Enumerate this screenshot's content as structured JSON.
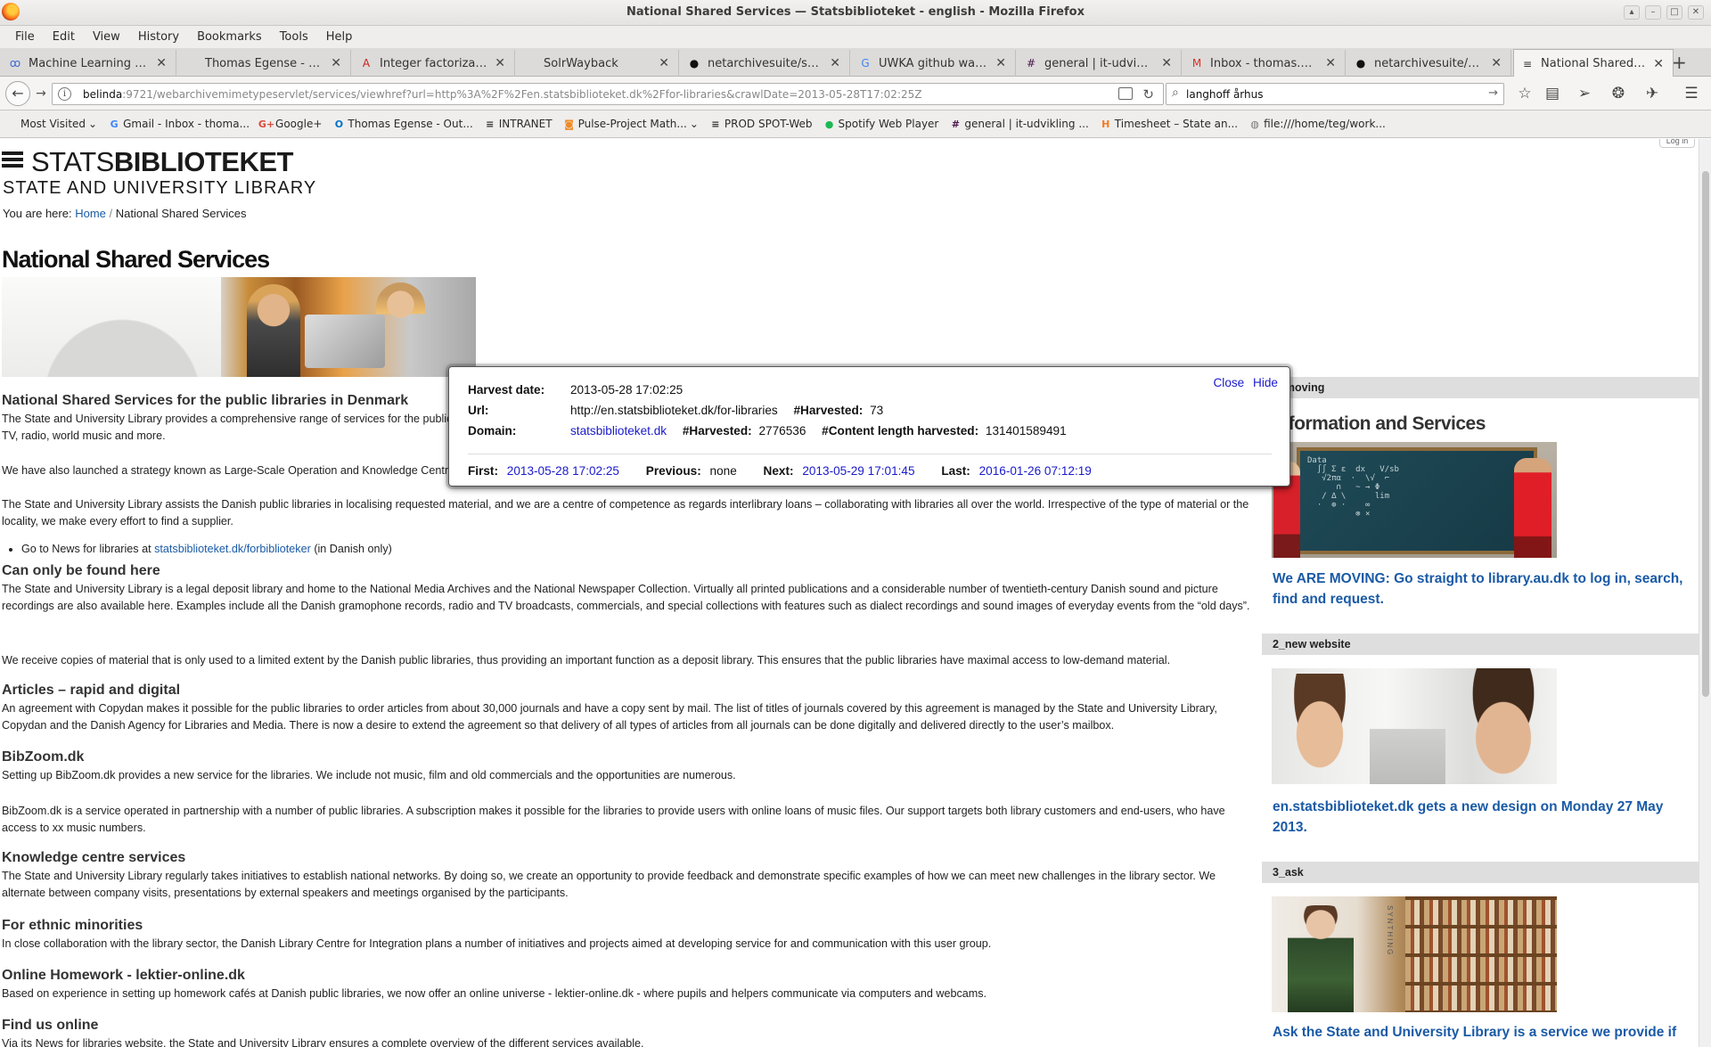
{
  "window": {
    "title": "National Shared Services — Statsbiblioteket - english - Mozilla Firefox",
    "controls": [
      "▴",
      "–",
      "□",
      "✕"
    ]
  },
  "menubar": [
    "File",
    "Edit",
    "View",
    "History",
    "Bookmarks",
    "Tools",
    "Help"
  ],
  "tabs": [
    {
      "label": "Machine Learning Fo...",
      "icon": "ꝏ",
      "icon_color": "#3a6bd8"
    },
    {
      "label": "Thomas Egense - Outloo...",
      "icon": "",
      "icon_color": "#888"
    },
    {
      "label": "Integer factorization ...",
      "icon": "A",
      "icon_color": "#c8201c"
    },
    {
      "label": "SolrWayback",
      "icon": "",
      "icon_color": "#888"
    },
    {
      "label": "netarchivesuite/solr...",
      "icon": "●",
      "icon_color": "#111"
    },
    {
      "label": "UWKA github warc in...",
      "icon": "G",
      "icon_color": "#4285f4"
    },
    {
      "label": "general | it-udvikling...",
      "icon": "#",
      "icon_color": "#4a154b"
    },
    {
      "label": "Inbox - thomas.egen...",
      "icon": "M",
      "icon_color": "#d93025"
    },
    {
      "label": "netarchivesuite/solr...",
      "icon": "●",
      "icon_color": "#111"
    },
    {
      "label": "National Shared Ser...",
      "icon": "≡",
      "icon_color": "#333"
    }
  ],
  "new_tab": "+",
  "close_glyph": "✕",
  "nav": {
    "back": "←",
    "forward": "→",
    "info": "i",
    "url_host": "belinda",
    "url_rest": ":9721/webarchivemimetypeservlet/services/viewhref?url=http%3A%2F%2Fen.statsbiblioteket.dk%2Ffor-libraries&crawlDate=2013-05-28T17:02:25Z",
    "reload": "↻",
    "search_value": "langhoff århus",
    "search_icon": "⌕",
    "search_go": "→"
  },
  "toolbar_icons": [
    "☆",
    "▤",
    "➢",
    "❂",
    "✈",
    "☰"
  ],
  "bookmarks": [
    {
      "label": "Most Visited",
      "icon": "",
      "icon_color": "#b8860b",
      "dropdown": "⌄"
    },
    {
      "label": "Gmail - Inbox - thoma...",
      "icon": "G",
      "icon_color": "#4285f4",
      "dropdown": ""
    },
    {
      "label": "Google+",
      "icon": "G+",
      "icon_color": "#dd4b39",
      "dropdown": ""
    },
    {
      "label": "Thomas Egense - Out...",
      "icon": "O",
      "icon_color": "#0072c6",
      "dropdown": ""
    },
    {
      "label": "INTRANET",
      "icon": "≡",
      "icon_color": "#333",
      "dropdown": ""
    },
    {
      "label": "Pulse-Project Math...",
      "icon": "◙",
      "icon_color": "#f08a24",
      "dropdown": "⌄"
    },
    {
      "label": "PROD SPOT-Web",
      "icon": "≡",
      "icon_color": "#333",
      "dropdown": ""
    },
    {
      "label": "Spotify Web Player",
      "icon": "●",
      "icon_color": "#1db954",
      "dropdown": ""
    },
    {
      "label": "general | it-udvikling ...",
      "icon": "#",
      "icon_color": "#4a154b",
      "dropdown": ""
    },
    {
      "label": "Timesheet – State an...",
      "icon": "H",
      "icon_color": "#f47b20",
      "dropdown": ""
    },
    {
      "label": "file:///home/teg/work...",
      "icon": "◍",
      "icon_color": "#777",
      "dropdown": ""
    }
  ],
  "page": {
    "login_label": "Log in",
    "logo_line1_a": "STATS",
    "logo_line1_b": "BIBLIOTEKET",
    "logo_line2": "STATE AND UNIVERSITY LIBRARY",
    "breadcrumb_prefix": "You are here:",
    "breadcrumb_home": "Home",
    "breadcrumb_sep": "/",
    "breadcrumb_current": "National Shared Services",
    "title": "National Shared Services",
    "sections": {
      "h_public": "National Shared Services for the public libraries in Denmark",
      "p_public_1": "The State and University Library provides a comprehensive range of services for the public libraries: national loan service, national and foreign interlibrary loans, technical infrastructure, music (via Bibzoom.dk), nationwide licensing agreements for film, TV, radio, world music and more.",
      "p_public_2": "We have also launched a strategy known as Large-Scale Operation and Knowledge Centre services for the public libraries in Denmark.",
      "p_public_3": "The State and University Library assists the Danish public libraries in localising requested material, and we are a centre of competence as regards interlibrary loans – collaborating with libraries all over the world. Irrespective of the type of material or the locality, we make every effort to find a supplier.",
      "li_news_prefix": "Go to News for libraries at",
      "li_news_link": "statsbiblioteket.dk/forbiblioteker",
      "li_news_suffix": "(in Danish only)",
      "h_only": "Can only be found here",
      "p_only_1": "The State and University Library is a legal deposit library and home to the National Media Archives and the National Newspaper Collection. Virtually all printed publications and a considerable number of twentieth-century Danish sound and picture recordings are also available here. Examples include all the Danish gramophone records, radio and TV broadcasts, commercials, and special collections with features such as dialect recordings and sound images of everyday events from the “old days”.",
      "p_only_2": "We receive copies of material that is only used to a limited extent by the Danish public libraries, thus providing an important function as a deposit library. This ensures that the public libraries have maximal access to low-demand material.",
      "h_articles": "Articles – rapid and digital",
      "p_articles": "An agreement with Copydan makes it possible for the public libraries to order articles from about 30,000 journals and have a copy sent by mail. The list of titles of journals covered by this agreement is managed by the State and University Library, Copydan and the Danish Agency for Libraries and Media. There is now a desire to extend the agreement so that delivery of all types of articles from all journals can be done digitally and delivered directly to the user’s mailbox.",
      "h_bibzoom": "BibZoom.dk",
      "p_bibzoom_1": "Setting up BibZoom.dk provides a new service for the libraries. We include not music, film and old commercials and the opportunities are numerous.",
      "p_bibzoom_2": "BibZoom.dk is a service operated in partnership with a number of public libraries. A subscription makes it possible for the libraries to provide users with online loans of music files. Our support targets both library customers and end-users, who have access to xx music numbers.",
      "h_knowledge": "Knowledge centre services",
      "p_knowledge": "The State and University Library regularly takes initiatives to establish national networks. By doing so, we create an opportunity to provide feedback and demonstrate specific examples of how we can meet new challenges in the library sector. We alternate between company visits, presentations by external speakers and meetings organised by the participants.",
      "h_ethnic": "For ethnic minorities",
      "p_ethnic": "In close collaboration with the library sector, the Danish Library Centre for Integration plans a number of initiatives and projects aimed at developing service for and communication with this user group.",
      "h_homework": "Online Homework - lektier-online.dk",
      "p_homework": "Based on experience in setting up homework cafés at Danish public libraries, we now offer an online universe - lektier-online.dk - where pupils and helpers communicate via computers and webcams.",
      "h_find": "Find us online",
      "p_find": "Via its News for libraries website, the State and University Library ensures a complete overview of the different services available."
    },
    "sidebar": {
      "head_1": "1_moving",
      "title_1": "Information and Services",
      "chalk_text": "Data\n  ∫∫ Σ ε  dx   V/sb\n   √2πα  ·  \\√  ⌐\n      ∩   ~ → Φ\n   / ∆ \\      lim\n  ·  ⊕ ·    ∞\n          ⊗ ×",
      "link_1": "We ARE MOVING: Go straight to library.au.dk to log in, search, find and request.",
      "head_2": "2_new website",
      "link_2": "en.statsbiblioteket.dk gets a new design on Monday 27 May 2013.",
      "head_3": "3_ask",
      "img3_vertical_text": "SYNTHING",
      "link_3": "Ask the State and University Library is a service we provide if"
    }
  },
  "harvest_popup": {
    "close": "Close",
    "hide": "Hide",
    "harvest_date_label": "Harvest date:",
    "harvest_date": "2013-05-28 17:02:25",
    "url_label": "Url:",
    "url": "http://en.statsbiblioteket.dk/for-libraries",
    "url_harvested_label": "#Harvested:",
    "url_harvested": "73",
    "domain_label": "Domain:",
    "domain": "statsbiblioteket.dk",
    "domain_harvested_label": "#Harvested:",
    "domain_harvested": "2776536",
    "content_length_label": "#Content length harvested:",
    "content_length": "131401589491",
    "first_label": "First:",
    "first": "2013-05-28 17:02:25",
    "previous_label": "Previous:",
    "previous": "none",
    "next_label": "Next:",
    "next": "2013-05-29 17:01:45",
    "last_label": "Last:",
    "last": "2016-01-26 07:12:19"
  }
}
